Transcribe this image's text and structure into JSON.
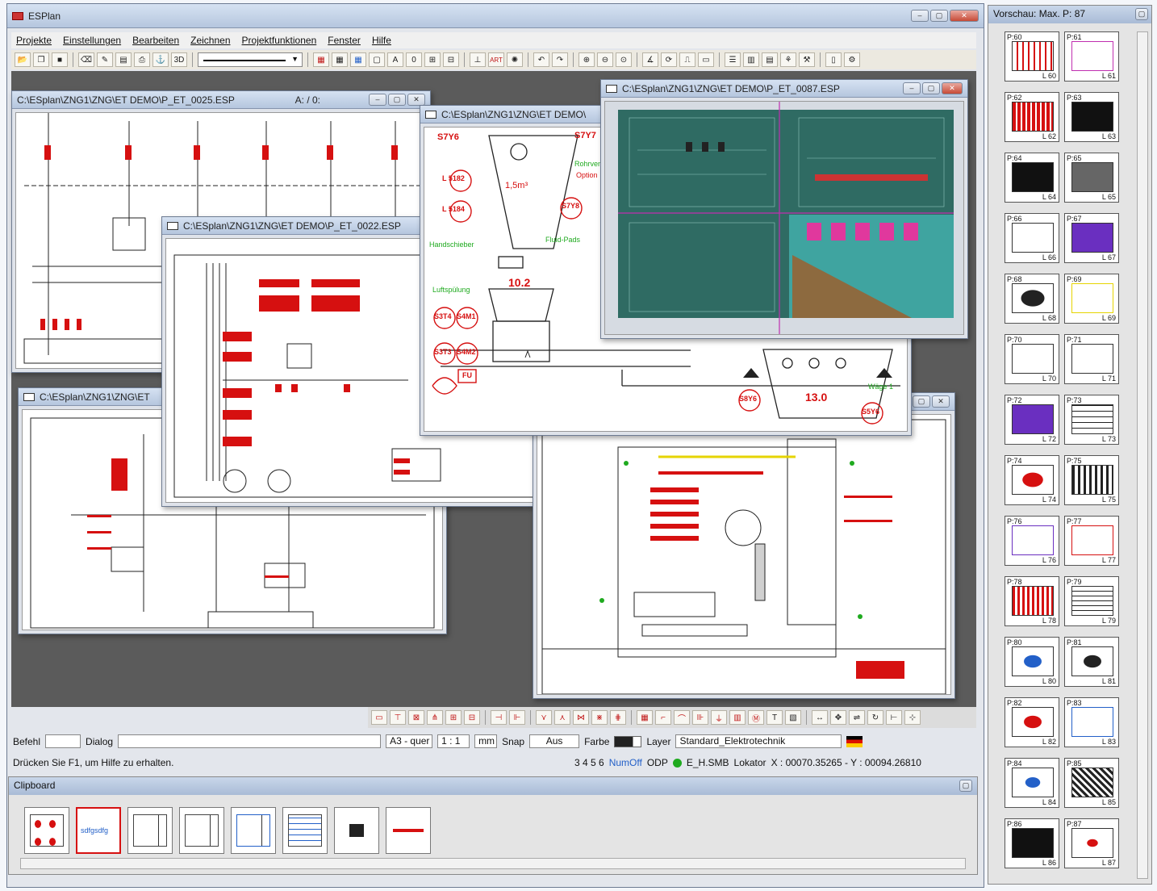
{
  "app": {
    "title": "ESPlan"
  },
  "menu": [
    "Projekte",
    "Einstellungen",
    "Bearbeiten",
    "Zeichnen",
    "Projektfunktionen",
    "Fenster",
    "Hilfe"
  ],
  "toolbar": {
    "zoom_3d": "3D",
    "count": "0",
    "art": "ART"
  },
  "windows": {
    "w1": {
      "title": "C:\\ESplan\\ZNG1\\ZNG\\ET DEMO\\P_ET_0025.ESP",
      "suffix": "A: / 0:"
    },
    "w2": {
      "title": "C:\\ESplan\\ZNG1\\ZNG\\ET DEMO\\P_ET_0022.ESP"
    },
    "w3": {
      "title": "C:\\ESplan\\ZNG1\\ZNG\\ET DEMO\\"
    },
    "w4": {
      "title": "C:\\ESplan\\ZNG1\\ZNG\\ET DEMO\\P_ET_0087.ESP"
    },
    "w5": {
      "title": "C:\\ESplan\\ZNG1\\ZNG\\ET"
    }
  },
  "process": {
    "tags": [
      "S7Y6",
      "S7Y7",
      "L 5182",
      "L 5184",
      "S7Y8",
      "S3T4",
      "S4M1",
      "S3T3",
      "S4M2",
      "FU",
      "S8Y6",
      "S5Y6"
    ],
    "volume": "1,5m³",
    "value1": "10.2",
    "value2": "13.0",
    "labels": [
      "Handschieber",
      "Fluid-Pads",
      "Luftspülung",
      "Wäge 1",
      "Rohrventil",
      "Option"
    ]
  },
  "statusbar": {
    "befehl": "Befehl",
    "dialog": "Dialog",
    "format": "A3 - quer",
    "scale": "1 : 1",
    "unit": "mm",
    "snap": "Snap",
    "snap_value": "Aus",
    "farbe": "Farbe",
    "layer": "Layer",
    "layer_value": "Standard_Elektrotechnik",
    "help": "Drücken Sie F1, um Hilfe zu erhalten.",
    "nums": "3  4  5  6",
    "numoff": "NumOff",
    "odp": "ODP",
    "file": "E_H.SMB",
    "lokator": "Lokator",
    "coords": "X : 00070.35265 - Y : 00094.26810"
  },
  "clipboard": {
    "title": "Clipboard",
    "item2": "sdfgsdfg"
  },
  "preview": {
    "title": "Vorschau: Max. P: 87",
    "items": [
      {
        "p": "P:60",
        "l": "L 60"
      },
      {
        "p": "P:61",
        "l": "L 61"
      },
      {
        "p": "P:62",
        "l": "L 62"
      },
      {
        "p": "P:63",
        "l": "L 63"
      },
      {
        "p": "P:64",
        "l": "L 64"
      },
      {
        "p": "P:65",
        "l": "L 65"
      },
      {
        "p": "P:66",
        "l": "L 66"
      },
      {
        "p": "P:67",
        "l": "L 67"
      },
      {
        "p": "P:68",
        "l": "L 68"
      },
      {
        "p": "P:69",
        "l": "L 69"
      },
      {
        "p": "P:70",
        "l": "L 70"
      },
      {
        "p": "P:71",
        "l": "L 71"
      },
      {
        "p": "P:72",
        "l": "L 72"
      },
      {
        "p": "P:73",
        "l": "L 73"
      },
      {
        "p": "P:74",
        "l": "L 74"
      },
      {
        "p": "P:75",
        "l": "L 75"
      },
      {
        "p": "P:76",
        "l": "L 76"
      },
      {
        "p": "P:77",
        "l": "L 77"
      },
      {
        "p": "P:78",
        "l": "L 78"
      },
      {
        "p": "P:79",
        "l": "L 79"
      },
      {
        "p": "P:80",
        "l": "L 80"
      },
      {
        "p": "P:81",
        "l": "L 81"
      },
      {
        "p": "P:82",
        "l": "L 82"
      },
      {
        "p": "P:83",
        "l": "L 83"
      },
      {
        "p": "P:84",
        "l": "L 84"
      },
      {
        "p": "P:85",
        "l": "L 85"
      },
      {
        "p": "P:86",
        "l": "L 86"
      },
      {
        "p": "P:87",
        "l": "L 87"
      }
    ]
  },
  "colors": {
    "accent_red": "#d61010",
    "accent_green": "#1faa1f",
    "title_blue": "#b5c6de",
    "workspace": "#5a5a5a"
  }
}
